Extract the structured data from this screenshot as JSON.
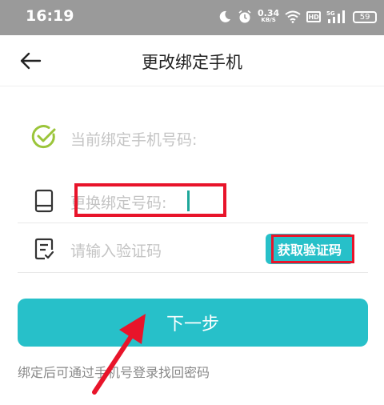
{
  "status_bar": {
    "time": "16:19",
    "speed_value": "0.34",
    "speed_unit": "KB/S",
    "hd_label": "HD",
    "network_label": "5G",
    "battery": "59"
  },
  "header": {
    "title": "更改绑定手机"
  },
  "form": {
    "current_phone_label": "当前绑定手机号码:",
    "new_phone_placeholder": "更换绑定号码:",
    "code_placeholder": "请输入验证码",
    "get_code_label": "获取验证码"
  },
  "next_button_label": "下一步",
  "hint": "绑定后可通过手机号登录找回密码",
  "colors": {
    "accent": "#27c0c9",
    "check_green": "#9bc53a",
    "annotation_red": "#e8142a"
  }
}
